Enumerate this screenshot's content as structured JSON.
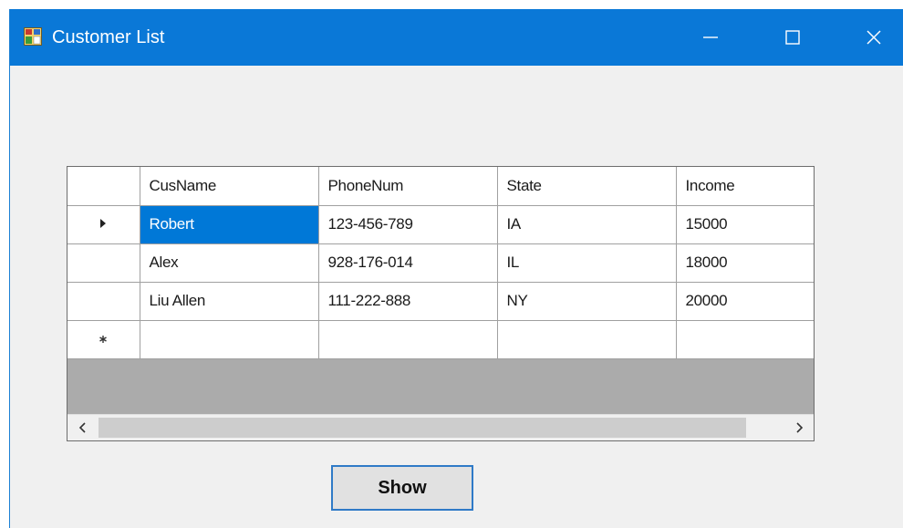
{
  "window": {
    "title": "Customer List",
    "icon": "form-app-icon",
    "controls": [
      "minimize-icon",
      "maximize-icon",
      "close-icon"
    ]
  },
  "grid": {
    "columns": [
      "CusName",
      "PhoneNum",
      "State",
      "Income"
    ],
    "rows": [
      {
        "indicator": "current-row-arrow-icon",
        "cells": [
          "Robert",
          "123-456-789",
          "IA",
          "15000"
        ],
        "selected_cell": 0
      },
      {
        "indicator": "",
        "cells": [
          "Alex",
          "928-176-014",
          "IL",
          "18000"
        ]
      },
      {
        "indicator": "",
        "cells": [
          "Liu Allen",
          "111-222-888",
          "NY",
          "20000"
        ]
      }
    ],
    "new_row_indicator": "new-row-asterisk-icon",
    "scrollbar": {
      "left_icon": "scroll-left-icon",
      "right_icon": "scroll-right-icon"
    }
  },
  "show_button": {
    "label": "Show"
  },
  "colors": {
    "titlebar": "#0a78d7",
    "selection": "#0078d7",
    "window_bg": "#f0f0f0",
    "grid_empty_bg": "#ababab",
    "button_border": "#2f7ac7"
  }
}
